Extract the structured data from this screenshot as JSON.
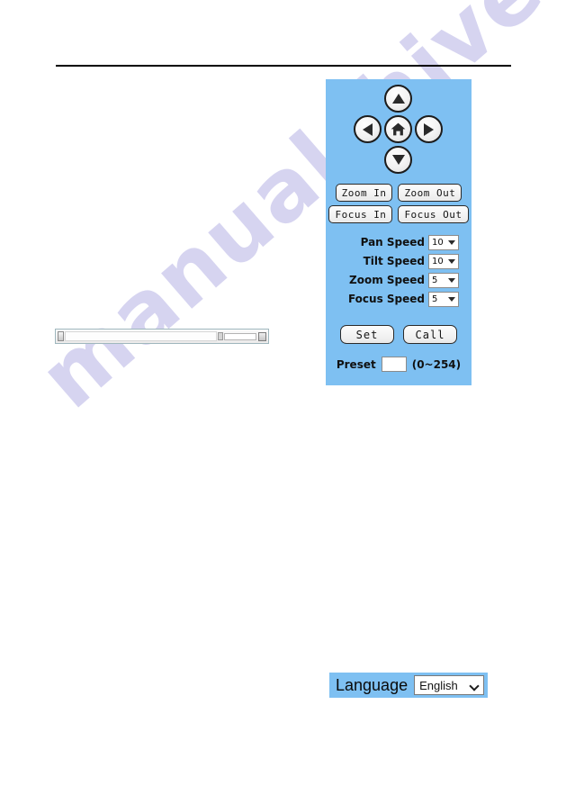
{
  "watermark": {
    "text": "manualshive.com"
  },
  "ptz_panel": {
    "accent_color": "#7ec0f2",
    "dpad": {
      "up_label": "Up",
      "left_label": "Left",
      "home_label": "Home",
      "right_label": "Right",
      "down_label": "Down"
    },
    "buttons": [
      {
        "label": "Zoom In"
      },
      {
        "label": "Zoom Out"
      },
      {
        "label": "Focus In"
      },
      {
        "label": "Focus Out"
      }
    ],
    "speeds": [
      {
        "label": "Pan Speed",
        "value": "10"
      },
      {
        "label": "Tilt Speed",
        "value": "10"
      },
      {
        "label": "Zoom Speed",
        "value": "5"
      },
      {
        "label": "Focus Speed",
        "value": "5"
      }
    ],
    "set_label": "Set",
    "call_label": "Call",
    "preset": {
      "label": "Preset",
      "value": "",
      "range_hint": "(0~254)"
    }
  },
  "language_bar": {
    "label": "Language",
    "selected": "English"
  }
}
